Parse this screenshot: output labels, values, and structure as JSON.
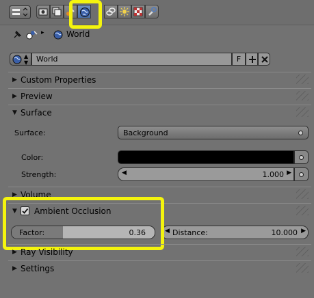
{
  "header": {
    "view_selector_icon": "editor-type-icon",
    "tabs": [
      {
        "name": "render-tab-icon",
        "active": false
      },
      {
        "name": "render-layers-tab-icon",
        "active": false
      },
      {
        "name": "scene-tab-icon",
        "active": false
      },
      {
        "name": "world-tab-icon",
        "active": true
      },
      {
        "name": "constraints-tab-icon",
        "active": false
      },
      {
        "name": "particles-tab-icon",
        "active": false
      },
      {
        "name": "texture-tab-icon",
        "active": false
      },
      {
        "name": "modifier-tab-icon",
        "active": false
      }
    ]
  },
  "breadcrumb": {
    "world_label": "World"
  },
  "datablock": {
    "name": "World",
    "fake_user": "F"
  },
  "panels": {
    "custom_properties": "Custom Properties",
    "preview": "Preview",
    "surface": "Surface",
    "volume": "Volume",
    "ambient_occlusion": "Ambient Occlusion",
    "ray_visibility": "Ray Visibility",
    "settings": "Settings"
  },
  "surface": {
    "surface_label": "Surface:",
    "surface_value": "Background",
    "color_label": "Color:",
    "color_value": "#000000",
    "strength_label": "Strength:",
    "strength_value": "1.000"
  },
  "ao": {
    "enabled": true,
    "factor_label": "Factor:",
    "factor_value": "0.36",
    "factor_fraction": 0.36,
    "distance_label": "Distance:",
    "distance_value": "10.000"
  },
  "colors": {
    "highlight": "#f4f40e",
    "active_tab": "#5a7db5"
  }
}
